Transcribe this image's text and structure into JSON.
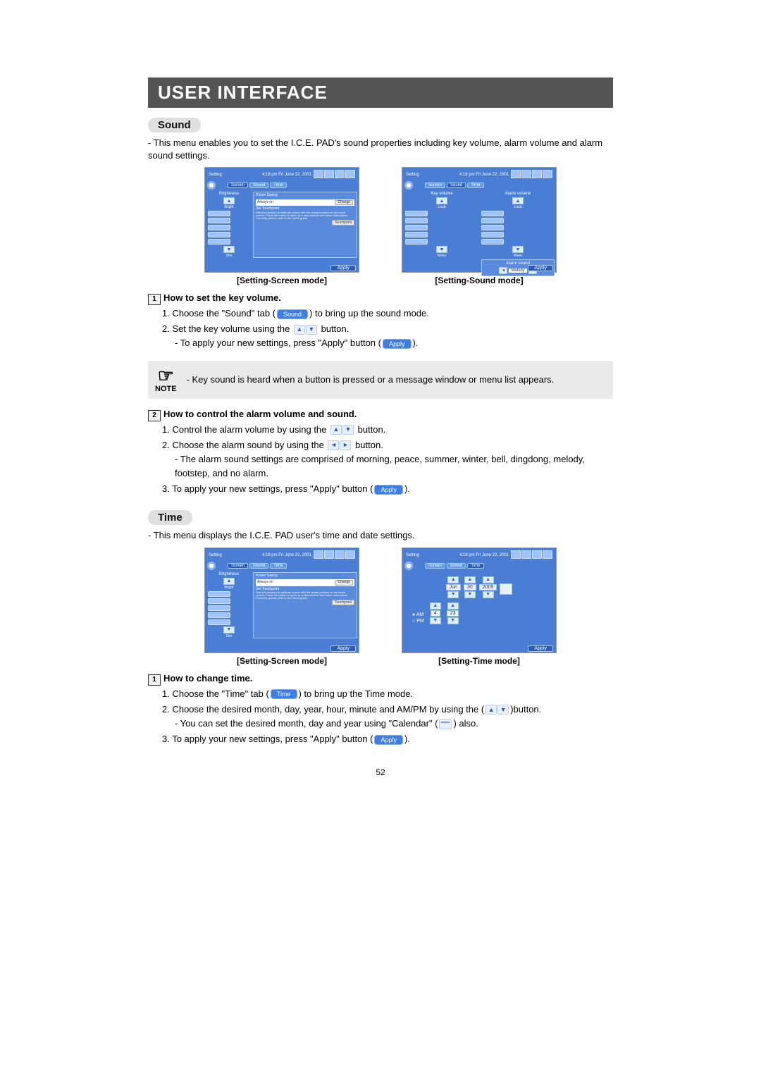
{
  "title": "USER INTERFACE",
  "page_number": "52",
  "sound_section": {
    "heading": "Sound",
    "intro": "- This menu enables you to set the I.C.E. PAD's sound properties including key volume, alarm volume and alarm sound settings.",
    "caption_left": "[Setting-Screen mode]",
    "caption_right": "[Setting-Sound mode]",
    "how1_title": "How to set the key volume.",
    "how1_steps": {
      "s1a": "1. Choose the \"Sound\" tab (",
      "s1_pill": "Sound",
      "s1b": ") to bring up the sound mode.",
      "s2a": "2. Set the key volume using the ",
      "s2b": " button.",
      "s2c": "- To apply your new settings, press \"Apply\" button (",
      "s2_pill": "Apply",
      "s2d": ")."
    },
    "note_label": "NOTE",
    "note_text": "- Key sound is heard when a button is pressed or a message window or menu list appears.",
    "how2_title": "How to control the alarm volume and sound.",
    "how2": {
      "s1a": "1. Control the alarm volume by using the ",
      "s1b": " button.",
      "s2a": "2. Choose the alarm sound by using the ",
      "s2b": " button.",
      "s2c": "- The alarm sound settings are comprised of morning, peace, summer, winter, bell, dingdong, melody, footstep, and no alarm.",
      "s3a": "3. To apply your new settings, press \"Apply\" button (",
      "s3_pill": "Apply",
      "s3b": ")."
    }
  },
  "time_section": {
    "heading": "Time",
    "intro": "- This menu displays the I.C.E. PAD user's time and date settings.",
    "caption_left": "[Setting-Screen mode]",
    "caption_right": "[Setting-Time mode]",
    "how_title": "How to change time.",
    "steps": {
      "s1a": "1. Choose the \"Time\" tab (",
      "s1_pill": "Time",
      "s1b": ") to bring up the Time mode.",
      "s2a": "2. Choose the desired month, day, year, hour, minute and AM/PM by using the (",
      "s2b": ")button.",
      "s2c": "- You can set the desired month, day and year using \"Calendar\" (",
      "s2d": ") also.",
      "s3a": "3. To apply your new settings, press \"Apply\" button (",
      "s3_pill": "Apply",
      "s3b": ")."
    }
  },
  "device": {
    "setting_label": "Setting",
    "clock_text": "4:19 pm Fri June 22, 2001",
    "tab_screen": "Screen",
    "tab_sound": "Sound",
    "tab_time": "Time",
    "brightness": "Brightness",
    "bright": "Bright",
    "dim": "Dim",
    "power_saving": "Power Saving",
    "always_on": "Always on",
    "change": "Change",
    "set_touchpoint": "Set Touchpoint",
    "touchpoint_desc": "Use this function to calibrate cursor with the actual position on the touch screen. Press the button to open up a new window and follow instructions. Currently, please refer to the user's guide.",
    "touchpoint_btn": "Touchpoint",
    "apply": "Apply",
    "key_volume": "Key volume",
    "alarm_volume": "Alarm volume",
    "loud": "Loud",
    "none": "None",
    "alarm_sound": "Alarm sound",
    "melody": "Melody",
    "month": "Jun",
    "day": "30",
    "year": "2005",
    "hour": "4",
    "minute": "23",
    "am": "AM",
    "pm": "PM"
  }
}
